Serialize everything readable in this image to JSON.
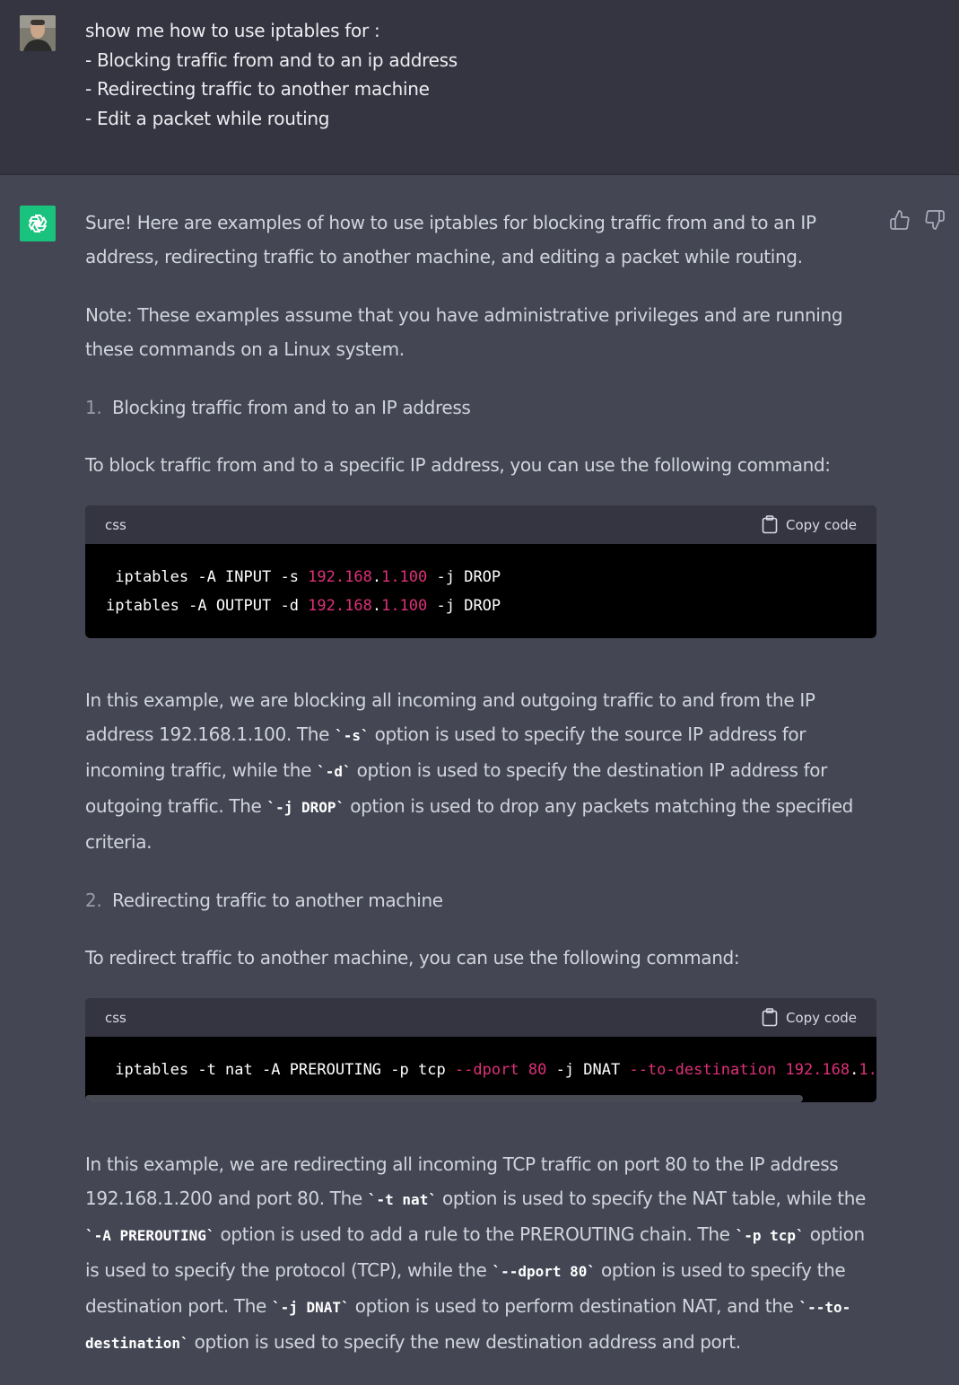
{
  "user": {
    "message": "show me how to use iptables for :\n- Blocking traffic from and to an ip address\n- Redirecting traffic to another machine\n- Edit a packet while routing"
  },
  "assistant": {
    "intro": "Sure! Here are examples of how to use iptables for blocking traffic from and to an IP address, redirecting traffic to another machine, and editing a packet while routing.",
    "note": "Note: These examples assume that you have administrative privileges and are running these commands on a Linux system.",
    "item1_num": "1.",
    "item1_label": "Blocking traffic from and to an IP address",
    "block_intro": "To block traffic from and to a specific IP address, you can use the following command:",
    "code1": {
      "lang": "css",
      "copy_label": "Copy code"
    },
    "explain1": {
      "t1": "In this example, we are blocking all incoming and outgoing traffic to and from the IP address 192.168.1.100. The ",
      "c1": "`-s`",
      "t2": " option is used to specify the source IP address for incoming traffic, while the ",
      "c2": "`-d`",
      "t3": " option is used to specify the destination IP address for outgoing traffic. The ",
      "c3": "`-j DROP`",
      "t4": " option is used to drop any packets matching the specified criteria."
    },
    "item2_num": "2.",
    "item2_label": "Redirecting traffic to another machine",
    "redirect_intro": "To redirect traffic to another machine, you can use the following command:",
    "code2": {
      "lang": "css",
      "copy_label": "Copy code"
    },
    "explain2": {
      "t1": "In this example, we are redirecting all incoming TCP traffic on port 80 to the IP address 192.168.1.200 and port 80. The ",
      "c1": "`-t nat`",
      "t2": " option is used to specify the NAT table, while the ",
      "c2": "`-A PREROUTING`",
      "t3": " option is used to add a rule to the PREROUTING chain. The ",
      "c3": "`-p tcp`",
      "t4": " option is used to specify the protocol (TCP), while the ",
      "c4": "`--dport 80`",
      "t5": " option is used to specify the destination port. The ",
      "c5": "`-j DNAT`",
      "t6": " option is used to perform destination NAT, and the ",
      "c6": "`--to-destination`",
      "t7": " option is used to specify the new destination address and port."
    }
  },
  "colors": {
    "user_bg": "#343541",
    "assistant_bg": "#444654",
    "gpt_logo": "#19c37d",
    "code_number": "#df3079"
  }
}
